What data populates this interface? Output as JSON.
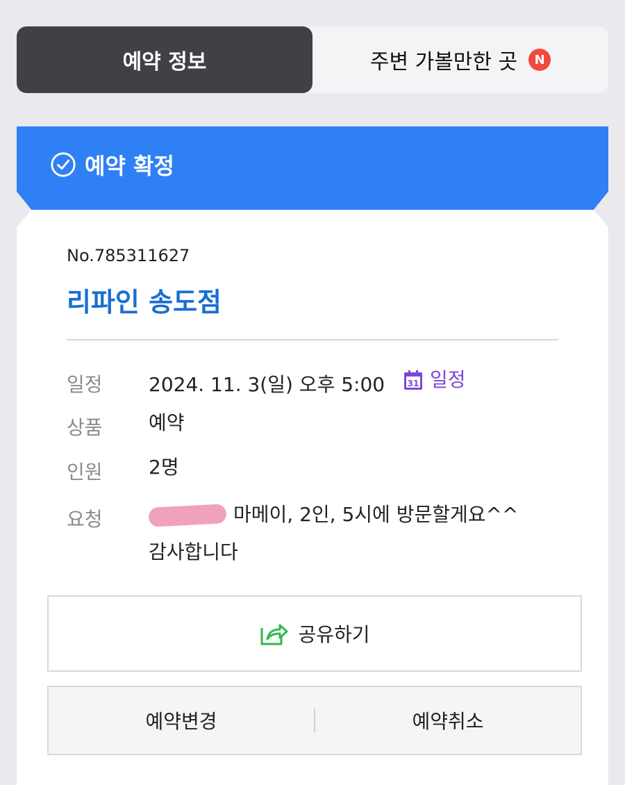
{
  "tabs": {
    "active_label": "예약 정보",
    "inactive_label": "주변 가볼만한 곳",
    "new_badge": "N"
  },
  "status": {
    "label": "예약 확정",
    "color": "#2f80f4"
  },
  "reservation": {
    "number": "No.785311627",
    "store_name": "리파인 송도점",
    "rows": {
      "schedule_label": "일정",
      "schedule_value": "2024. 11. 3(일) 오후 5:00",
      "calendar_icon_text": "31",
      "calendar_link": "일정",
      "product_label": "상품",
      "product_value": "예약",
      "people_label": "인원",
      "people_value": "2명",
      "request_label": "요청",
      "request_value": "마메이, 2인, 5시에 방문할게요^^",
      "request_value_line2": "감사합니다"
    }
  },
  "buttons": {
    "share": "공유하기",
    "change": "예약변경",
    "cancel": "예약취소"
  },
  "colors": {
    "accent_blue": "#2f80f4",
    "store_blue": "#1a6fd1",
    "calendar_purple": "#7a47d6",
    "share_green": "#2eb84a",
    "badge_red": "#ef4a3c"
  }
}
